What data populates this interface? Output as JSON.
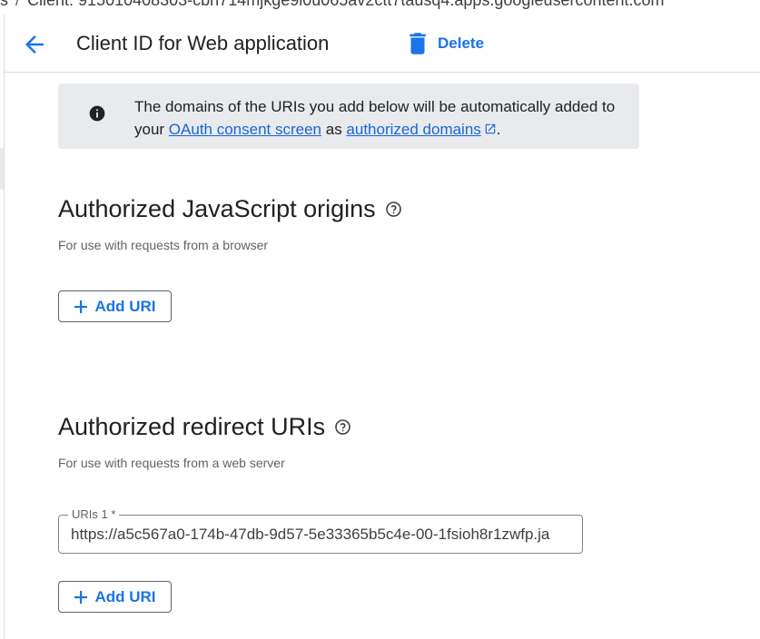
{
  "breadcrumb": {
    "prev_fragment": "s",
    "separator": "/",
    "current": "Client: 915010408303-cbh714mjkge9l0u065av2ctt7tausq4.apps.googleusercontent.com"
  },
  "header": {
    "title": "Client ID for Web application",
    "delete_label": "Delete"
  },
  "info_banner": {
    "text_before": "The domains of the URIs you add below will be automatically added to your ",
    "link1": "OAuth consent screen",
    "text_middle": " as ",
    "link2": "authorized domains",
    "text_after": "."
  },
  "js_origins": {
    "title": "Authorized JavaScript origins",
    "subtitle": "For use with requests from a browser",
    "add_label": "Add URI"
  },
  "redirect_uris": {
    "title": "Authorized redirect URIs",
    "subtitle": "For use with requests from a web server",
    "field_label": "URIs 1 *",
    "field_value": "https://a5c567a0-174b-47db-9d57-5e33365b5c4e-00-1fsioh8r1zwfp.ja",
    "add_label": "Add URI"
  },
  "colors": {
    "accent": "#1a73e8",
    "banner_bg": "#e8eaed",
    "link": "#1967d2"
  },
  "icons": {
    "back": "arrow-back-icon",
    "delete": "trash-icon",
    "info": "info-icon",
    "external": "external-link-icon",
    "help": "help-icon",
    "add": "plus-icon"
  }
}
